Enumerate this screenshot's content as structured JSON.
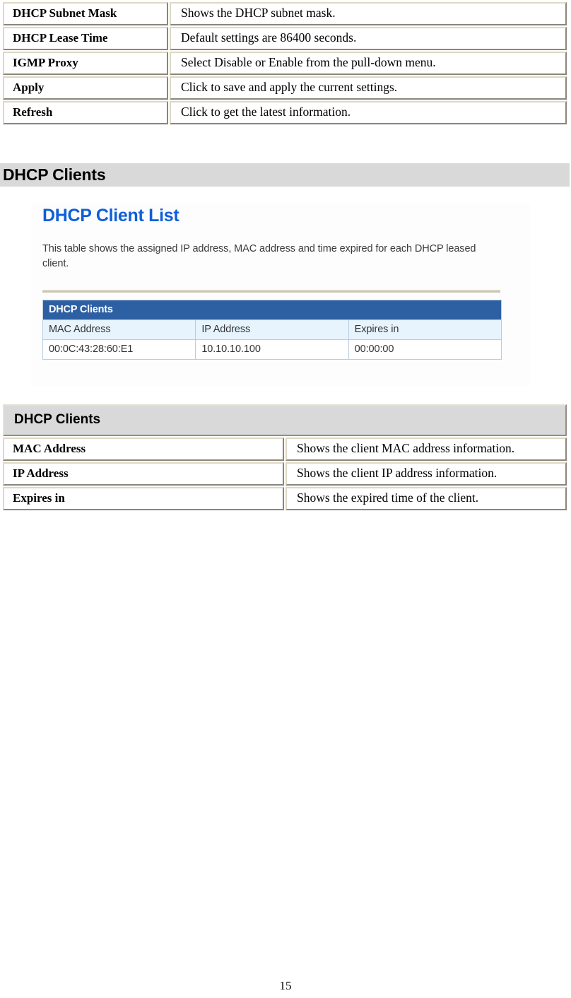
{
  "document": {
    "page_number": "15"
  },
  "settings_table": {
    "rows": [
      {
        "label": "DHCP Subnet Mask",
        "description": "Shows the DHCP subnet mask."
      },
      {
        "label": "DHCP Lease Time",
        "description": "Default settings are 86400 seconds."
      },
      {
        "label": "IGMP Proxy",
        "description": "Select Disable or Enable from the pull-down menu."
      },
      {
        "label": "Apply",
        "description": "Click to save and apply the current settings."
      },
      {
        "label": "Refresh",
        "description": "Click to get the latest information."
      }
    ]
  },
  "section": {
    "heading": "DHCP Clients"
  },
  "screenshot": {
    "title": "DHCP Client List",
    "description": "This table shows the assigned IP address, MAC address and time expired for each DHCP leased client.",
    "table": {
      "group_header": "DHCP Clients",
      "columns": [
        "MAC Address",
        "IP Address",
        "Expires in"
      ],
      "rows": [
        [
          "00:0C:43:28:60:E1",
          "10.10.10.100",
          "00:00:00"
        ]
      ]
    },
    "colors": {
      "header_blue": "#2d5fa3",
      "column_head_blue": "#e7f4fd",
      "title_blue": "#0e5fd8",
      "rule": "#cdc8b5"
    }
  },
  "clients_table": {
    "group_header": "DHCP Clients",
    "rows": [
      {
        "label": "MAC Address",
        "description": "Shows the client MAC address information."
      },
      {
        "label": "IP Address",
        "description": "Shows the client IP address information."
      },
      {
        "label": "Expires in",
        "description": "Shows the expired time of the client."
      }
    ]
  },
  "palette": {
    "band_gray": "#d9d9d9",
    "cell_border": "#ded8c4"
  }
}
